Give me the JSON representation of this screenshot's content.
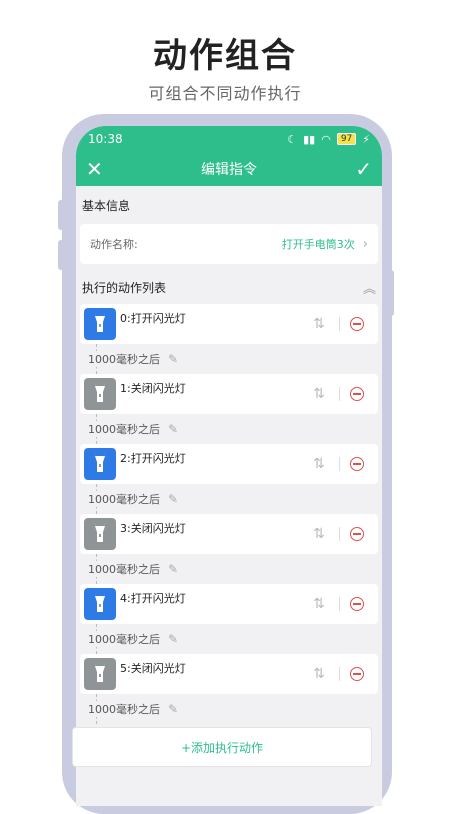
{
  "hero": {
    "title": "动作组合",
    "subtitle": "可组合不同动作执行"
  },
  "status": {
    "time": "10:38",
    "battery": "97"
  },
  "appbar": {
    "title": "编辑指令"
  },
  "basic": {
    "section": "基本信息",
    "name_label": "动作名称:",
    "name_value": "打开手电筒3次"
  },
  "list": {
    "header": "执行的动作列表",
    "actions": [
      {
        "label": "0:打开闪光灯",
        "state": "on",
        "delay": "1000毫秒之后"
      },
      {
        "label": "1:关闭闪光灯",
        "state": "off",
        "delay": "1000毫秒之后"
      },
      {
        "label": "2:打开闪光灯",
        "state": "on",
        "delay": "1000毫秒之后"
      },
      {
        "label": "3:关闭闪光灯",
        "state": "off",
        "delay": "1000毫秒之后"
      },
      {
        "label": "4:打开闪光灯",
        "state": "on",
        "delay": "1000毫秒之后"
      },
      {
        "label": "5:关闭闪光灯",
        "state": "off",
        "delay": "1000毫秒之后"
      }
    ]
  },
  "add_button": "+添加执行动作",
  "colors": {
    "accent": "#2dbe8b",
    "on_icon": "#2f7be6",
    "off_icon": "#8f9496",
    "danger": "#d9534f"
  }
}
